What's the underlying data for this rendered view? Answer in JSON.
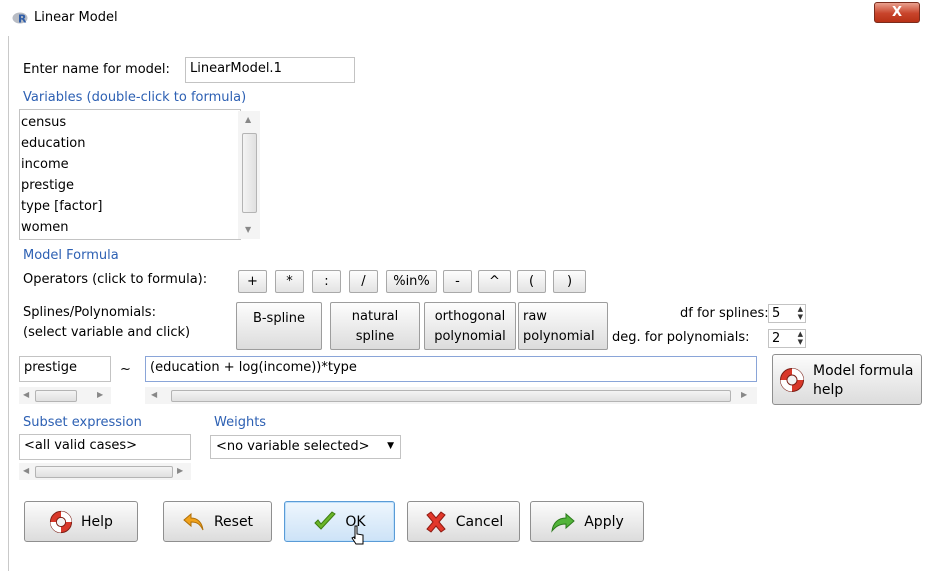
{
  "window": {
    "title": "Linear Model",
    "close_glyph": "X"
  },
  "model_name": {
    "label": "Enter name for model:",
    "value": "LinearModel.1"
  },
  "variables": {
    "header": "Variables (double-click to formula)",
    "items": [
      "census",
      "education",
      "income",
      "prestige",
      "type [factor]",
      "women"
    ]
  },
  "formula_section": {
    "header": "Model Formula",
    "operators_label": "Operators (click to formula):",
    "operators": [
      "+",
      "*",
      ":",
      "/",
      "%in%",
      "-",
      "^",
      "(",
      ")"
    ],
    "splines_label_1": "Splines/Polynomials:",
    "splines_label_2": "(select variable and click)",
    "spline_buttons": [
      {
        "line1": "B-spline",
        "line2": ""
      },
      {
        "line1": "natural",
        "line2": "spline"
      },
      {
        "line1": "orthogonal",
        "line2": "polynomial"
      },
      {
        "line1": "raw",
        "line2": "polynomial"
      }
    ],
    "df_splines_label": "df for splines:",
    "df_splines_value": "5",
    "deg_polynomials_label": "deg. for polynomials:",
    "deg_polynomials_value": "2",
    "lhs": "prestige",
    "tilde": "~",
    "rhs": "(education + log(income))*type",
    "help_label_1": "Model formula",
    "help_label_2": "help"
  },
  "subset": {
    "label": "Subset expression",
    "value": "<all valid cases>"
  },
  "weights": {
    "label": "Weights",
    "value": "<no variable selected>"
  },
  "buttons": {
    "help": "Help",
    "reset": "Reset",
    "ok": "OK",
    "cancel": "Cancel",
    "apply": "Apply"
  },
  "colors": {
    "section_blue": "#2d60b3",
    "close_red": "#c8442b",
    "ok_blue": "#cde3f7"
  }
}
